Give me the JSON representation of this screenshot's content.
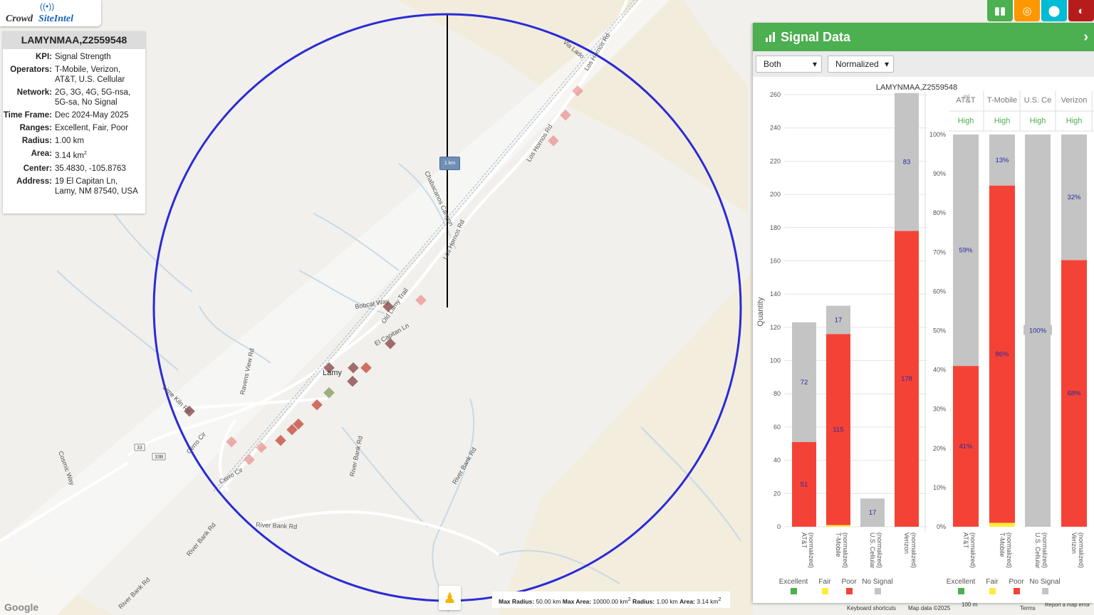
{
  "logo": {
    "crowd": "Crowd",
    "site": "SiteIntel"
  },
  "info": {
    "title": "LAMYNMAA,Z2559548",
    "kpi_label": "KPI:",
    "kpi": "Signal Strength",
    "operators_label": "Operators:",
    "operators": "T-Mobile, Verizon, AT&T, U.S. Cellular",
    "network_label": "Network:",
    "network": "2G, 3G, 4G, 5G-nsa, 5G-sa, No Signal",
    "timeframe_label": "Time Frame:",
    "timeframe": "Dec 2024-May 2025",
    "ranges_label": "Ranges:",
    "ranges": "Excellent, Fair, Poor",
    "radius_label": "Radius:",
    "radius": "1.00 km",
    "area_label": "Area:",
    "area": "3.14 km",
    "area_sup": "2",
    "center_label": "Center:",
    "center": "35.4830, -105.8763",
    "address_label": "Address:",
    "address": "19 El Capitan Ln, Lamy, NM 87540, USA"
  },
  "toolbar": {
    "buttons": [
      {
        "icon": "bar-chart-icon",
        "color": "#4caf50"
      },
      {
        "icon": "target-icon",
        "color": "#ff9800"
      },
      {
        "icon": "map-pin-icon",
        "color": "#00bcd4"
      },
      {
        "icon": "globe-icon",
        "color": "#b71c1c"
      }
    ]
  },
  "panel": {
    "title": "Signal Data",
    "filter_value": "Both",
    "mode_value": "Normalized"
  },
  "map": {
    "scale_label": "1 km",
    "place_label": "Lamy",
    "roads": [
      "Via Lado",
      "Los Hornos Rd",
      "Los Hornos Rd",
      "Los Hornos Rd",
      "Chabacanos Canyon",
      "Bobcat Way",
      "Old Lamy Trail",
      "El Capitan Ln",
      "Ravens View Rd",
      "Lime Kiln Rd",
      "Cerro Cir",
      "Cerro Cir",
      "River Bank Rd",
      "River Bank Rd",
      "River Bank Rd",
      "River Bank Rd",
      "River Bank Rd",
      "Cosmic Way",
      "33",
      "33B"
    ],
    "footer": {
      "max_radius_label": "Max Radius:",
      "max_radius": "50.00 km",
      "max_area_label": "Max Area:",
      "max_area": "10000.00 km",
      "radius_label": "Radius:",
      "radius": "1.00 km",
      "area_label": "Area:",
      "area": "3.14 km"
    },
    "attribution": {
      "keyboard": "Keyboard shortcuts",
      "mapdata": "Map data ©2025",
      "scale": "100 m",
      "terms": "Terms",
      "report": "Report a map error",
      "google": "Google"
    }
  },
  "chart_data": [
    {
      "type": "bar",
      "title": "LAMYNMAA,Z2559548",
      "ylabel": "Quantity",
      "ylim": [
        0,
        260
      ],
      "yticks": [
        0,
        20,
        40,
        60,
        80,
        100,
        120,
        140,
        160,
        180,
        200,
        220,
        240,
        260
      ],
      "categories": [
        "AT&T\n(normalized)",
        "T-Mobile\n(normalized)",
        "U.S. Cellular\n(normalized)",
        "Verizon\n(normalized)"
      ],
      "series": [
        {
          "name": "Excellent",
          "color": "#4caf50",
          "values": [
            0,
            0,
            0,
            0
          ]
        },
        {
          "name": "Fair",
          "color": "#ffeb3b",
          "values": [
            0,
            1,
            0,
            0
          ]
        },
        {
          "name": "Poor",
          "color": "#f44336",
          "values": [
            51,
            115,
            0,
            178
          ]
        },
        {
          "name": "No Signal",
          "color": "#c4c4c4",
          "values": [
            72,
            17,
            17,
            83
          ]
        }
      ],
      "labels": [
        [
          "51",
          "72"
        ],
        [
          "115",
          "17"
        ],
        [
          "",
          "17"
        ],
        [
          "178",
          "83"
        ]
      ]
    },
    {
      "type": "bar",
      "stacked_percent": true,
      "ylim": [
        0,
        100
      ],
      "yticks": [
        "0%",
        "10%",
        "20%",
        "30%",
        "40%",
        "50%",
        "60%",
        "70%",
        "80%",
        "90%",
        "100%"
      ],
      "headers": [
        "AT&T",
        "T-Mobile",
        "U.S. Ce",
        "Verizon"
      ],
      "header_sup": "(n)",
      "ratings": [
        "High",
        "High",
        "High",
        "High"
      ],
      "categories": [
        "AT&T\n(normalized)",
        "T-Mobile\n(normalized)",
        "U.S. Cellular\n(normalized)",
        "Verizon\n(normalized)"
      ],
      "series": [
        {
          "name": "Excellent",
          "color": "#4caf50",
          "values": [
            0,
            0,
            0,
            0
          ]
        },
        {
          "name": "Fair",
          "color": "#ffeb3b",
          "values": [
            0,
            1,
            0,
            0
          ]
        },
        {
          "name": "Poor",
          "color": "#f44336",
          "values": [
            41,
            86,
            0,
            68
          ]
        },
        {
          "name": "No Signal",
          "color": "#c4c4c4",
          "values": [
            59,
            13,
            100,
            32
          ]
        }
      ],
      "labels": [
        [
          "41%",
          "59%"
        ],
        [
          "86%",
          "13%"
        ],
        [
          "",
          "100%"
        ],
        [
          "68%",
          "32%"
        ]
      ]
    }
  ]
}
